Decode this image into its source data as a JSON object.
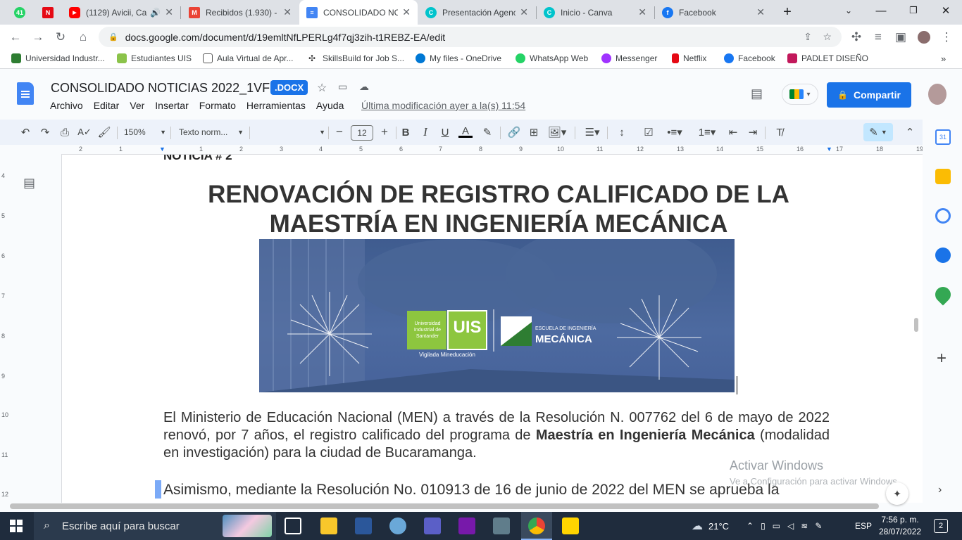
{
  "tabs": [
    {
      "title": "",
      "fav_color": "#25d366",
      "fav_text": "41"
    },
    {
      "title": "",
      "fav_color": "#e50914",
      "fav_text": "N"
    },
    {
      "title": "(1129) Avicii, Ca",
      "fav_color": "#ff0000",
      "fav_text": "▶"
    },
    {
      "title": "Recibidos (1.930) - c",
      "fav_color": "#ea4335",
      "fav_text": "M"
    },
    {
      "title": "CONSOLIDADO NC",
      "fav_color": "#4285f4",
      "fav_text": "≡"
    },
    {
      "title": "Presentación Agenc",
      "fav_color": "#00c4cc",
      "fav_text": "C"
    },
    {
      "title": "Inicio - Canva",
      "fav_color": "#00c4cc",
      "fav_text": "C"
    },
    {
      "title": "Facebook",
      "fav_color": "#1877f2",
      "fav_text": "f"
    }
  ],
  "url": "docs.google.com/document/d/19emltNfLPERLg4f7qj3zih-t1REBZ-EA/edit",
  "bookmarks": [
    {
      "label": "Universidad Industr...",
      "color": "#2e7d32"
    },
    {
      "label": "Estudiantes UIS",
      "color": "#8bc34a"
    },
    {
      "label": "Aula Virtual de Apr...",
      "color": "#555"
    },
    {
      "label": "SkillsBuild for Job S...",
      "color": "#333"
    },
    {
      "label": "My files - OneDrive",
      "color": "#0078d4"
    },
    {
      "label": "WhatsApp Web",
      "color": "#25d366"
    },
    {
      "label": "Messenger",
      "color": "#a033ff"
    },
    {
      "label": "Netflix",
      "color": "#e50914"
    },
    {
      "label": "Facebook",
      "color": "#1877f2"
    },
    {
      "label": "PADLET DISEÑO",
      "color": "#c2185b"
    }
  ],
  "doc": {
    "title": "CONSOLIDADO NOTICIAS 2022_1VF",
    "format": ".DOCX",
    "menu": [
      "Archivo",
      "Editar",
      "Ver",
      "Insertar",
      "Formato",
      "Herramientas",
      "Ayuda"
    ],
    "last_modified": "Última modificación ayer a la(s) 11:54",
    "share": "Compartir"
  },
  "toolbar": {
    "zoom": "150%",
    "style": "Texto norm...",
    "font_size": "12"
  },
  "content": {
    "prev": "NOTICIA # 2",
    "heading_line1": "RENOVACIÓN DE REGISTRO CALIFICADO DE LA",
    "heading_line2": "MAESTRÍA EN INGENIERÍA MECÁNICA",
    "logo_uis_1": "Universidad",
    "logo_uis_2": "Industrial de",
    "logo_uis_3": "Santander",
    "logo_uis_abbr": "UIS",
    "logo_sub": "Vigilada Mineducación",
    "logo_school_small": "ESCUELA DE INGENIERÍA",
    "logo_school_big": "MECÁNICA",
    "p1_a": "El Ministerio de Educación Nacional (MEN) a través de la Resolución N. 007762 del 6 de mayo de 2022 renovó, por 7 años, el registro calificado del programa de ",
    "p1_bold": "Maestría en Ingeniería Mecánica",
    "p1_b": " (modalidad en investigación) para la ciudad de Bucaramanga.",
    "p2": "Asimismo, mediante la Resolución No. 010913 de 16 de junio de 2022 del MEN se aprueba la"
  },
  "watermark": {
    "line1": "Activar Windows",
    "line2": "Ve a Configuración para activar Windows."
  },
  "taskbar": {
    "search": "Escribe aquí para buscar",
    "temp": "21°C",
    "lang": "ESP",
    "time": "7:56 p. m.",
    "date": "28/07/2022",
    "notif": "2"
  }
}
